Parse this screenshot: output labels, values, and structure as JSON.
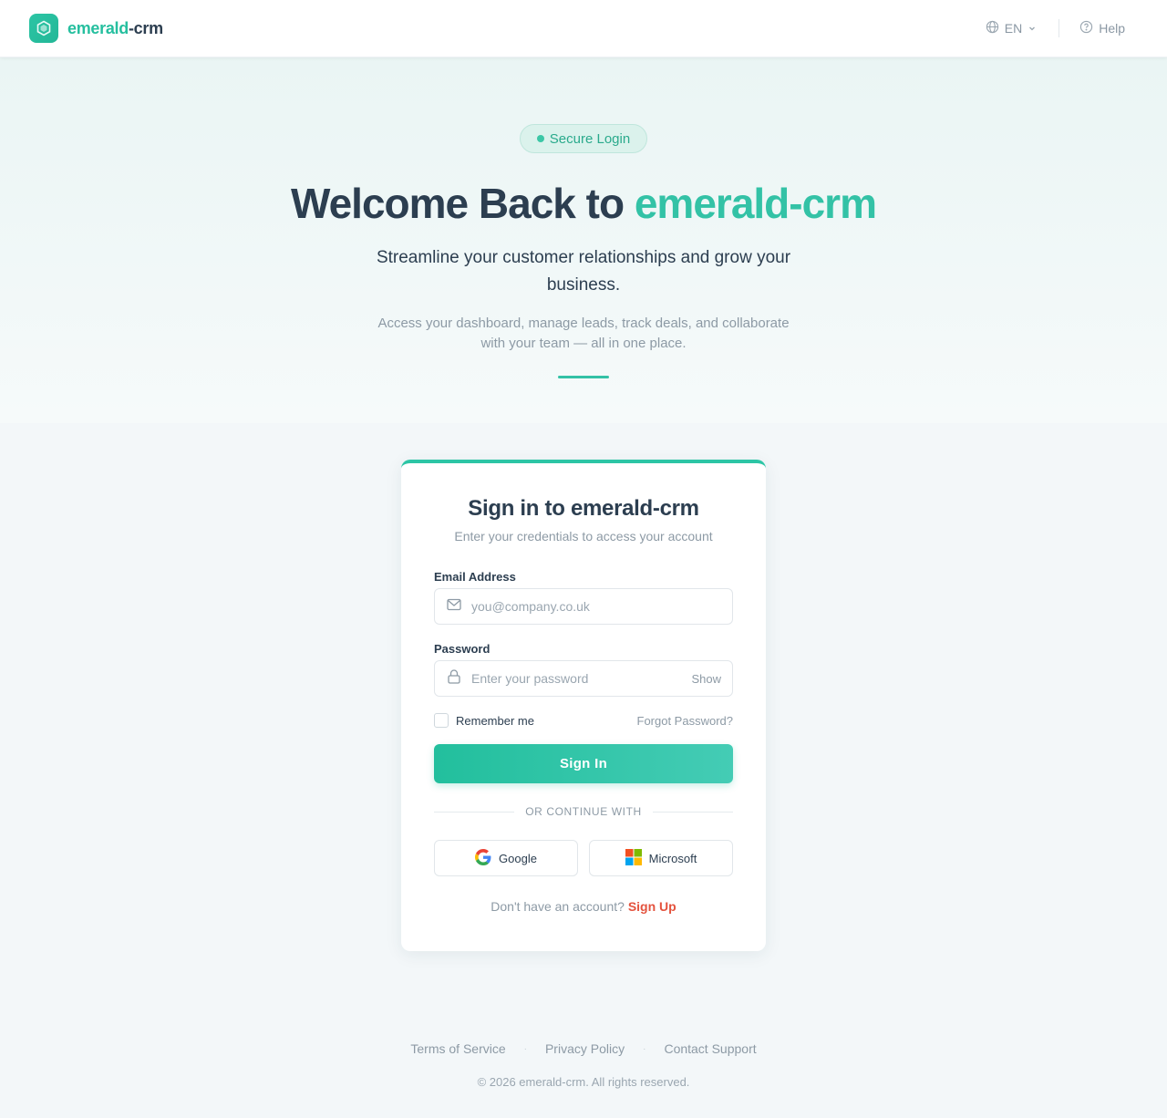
{
  "header": {
    "brand_accent": "emerald",
    "brand_rest": "-crm",
    "language": "EN",
    "help_label": "Help"
  },
  "hero": {
    "badge": "Secure Login",
    "title_prefix": "Welcome Back to ",
    "title_accent": "emerald-crm",
    "subtitle": "Streamline your customer relationships and grow your business.",
    "description": "Access your dashboard, manage leads, track deals, and collaborate with your team — all in one place."
  },
  "form": {
    "title": "Sign in to emerald-crm",
    "subtitle": "Enter your credentials to access your account",
    "email_label": "Email Address",
    "email_placeholder": "you@company.co.uk",
    "password_label": "Password",
    "password_placeholder": "Enter your password",
    "show_label": "Show",
    "remember_label": "Remember me",
    "forgot_label": "Forgot Password?",
    "submit_label": "Sign In",
    "divider_label": "OR CONTINUE WITH",
    "google_label": "Google",
    "microsoft_label": "Microsoft",
    "signup_prompt": "Don't have an account?",
    "signup_link": "Sign Up"
  },
  "footer": {
    "links": [
      "Terms of Service",
      "Privacy Policy",
      "Contact Support"
    ],
    "copyright": "© 2026 emerald-crm. All rights reserved."
  },
  "colors": {
    "accent": "#26bf9f",
    "signup_link": "#e4533e",
    "heading": "#2c3e50"
  },
  "icons": [
    "brand-logo-icon",
    "globe-icon",
    "chevron-down-icon",
    "help-circle-icon",
    "mail-icon",
    "lock-icon",
    "google-icon",
    "microsoft-icon"
  ]
}
